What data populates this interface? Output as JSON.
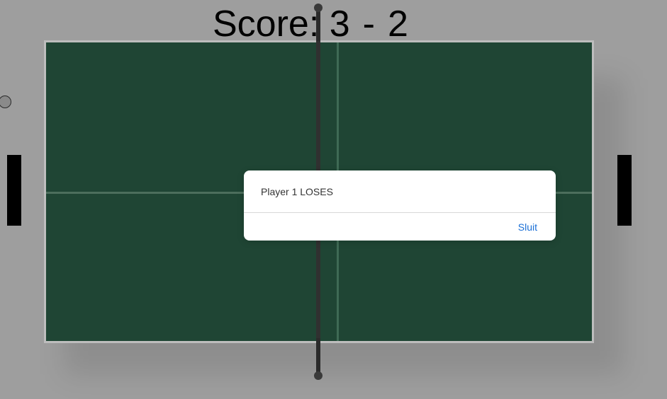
{
  "score": {
    "label": "Score:",
    "player1": "3",
    "separator": "-",
    "player2": "2"
  },
  "alert": {
    "message": "Player 1 LOSES",
    "close_button": "Sluit"
  },
  "colors": {
    "background": "#9e9e9e",
    "table": "#1f4534",
    "paddle": "#000000",
    "dialog_button": "#1a6fd6"
  }
}
